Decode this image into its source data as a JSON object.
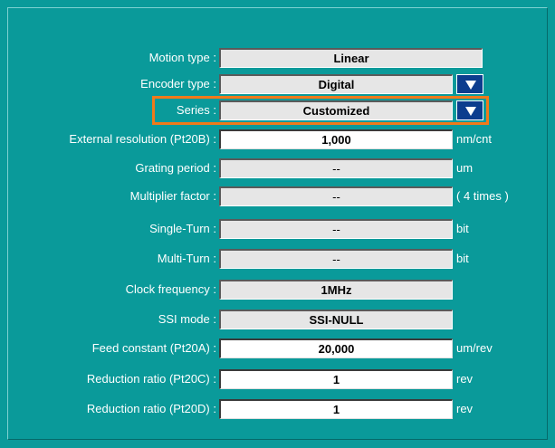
{
  "rows": {
    "motion_type": {
      "label": "Motion type :",
      "value": "Linear"
    },
    "encoder_type": {
      "label": "Encoder type :",
      "value": "Digital",
      "dropdown_icon": "triangle-down-icon"
    },
    "series": {
      "label": "Series :",
      "value": "Customized",
      "dropdown_icon": "triangle-down-icon"
    },
    "external_resolution": {
      "label": "External resolution (Pt20B) :",
      "value": "1,000",
      "unit": "nm/cnt"
    },
    "grating_period": {
      "label": "Grating period :",
      "value": "--",
      "unit": "um"
    },
    "multiplier_factor": {
      "label": "Multiplier factor :",
      "value": "--",
      "unit": "( 4 times )"
    },
    "single_turn": {
      "label": "Single-Turn :",
      "value": "--",
      "unit": "bit"
    },
    "multi_turn": {
      "label": "Multi-Turn :",
      "value": "--",
      "unit": "bit"
    },
    "clock_frequency": {
      "label": "Clock frequency :",
      "value": "1MHz"
    },
    "ssi_mode": {
      "label": "SSI mode :",
      "value": "SSI-NULL"
    },
    "feed_constant": {
      "label": "Feed constant (Pt20A) :",
      "value": "20,000",
      "unit": "um/rev"
    },
    "reduction_ratio_c": {
      "label": "Reduction ratio (Pt20C) :",
      "value": "1",
      "unit": "rev"
    },
    "reduction_ratio_d": {
      "label": "Reduction ratio (Pt20D) :",
      "value": "1",
      "unit": "rev"
    }
  },
  "colors": {
    "panel_background": "#0a9a9a",
    "dropdown_button": "#0c3d8e",
    "highlight_box": "#f07a1a",
    "readonly_field": "#e6e6e6",
    "edit_field": "#ffffff"
  }
}
